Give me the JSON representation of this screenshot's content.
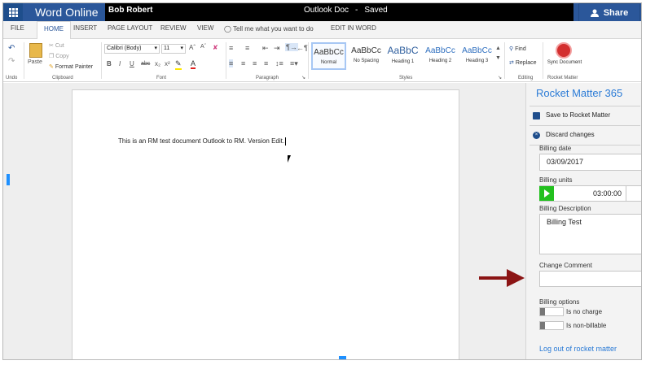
{
  "app": {
    "name": "Word Online",
    "user": "Bob Robert",
    "document_title": "Outlook Doc",
    "separator": "-",
    "save_status": "Saved",
    "share_label": "Share"
  },
  "menu": {
    "tabs": [
      {
        "label": "FILE"
      },
      {
        "label": "HOME"
      },
      {
        "label": "INSERT"
      },
      {
        "label": "PAGE LAYOUT"
      },
      {
        "label": "REVIEW"
      },
      {
        "label": "VIEW"
      }
    ],
    "tell_me": "Tell me what you want to do",
    "edit_in_word": "EDIT IN WORD"
  },
  "ribbon": {
    "undo_group": "Undo",
    "paste": "Paste",
    "cut": "Cut",
    "copy": "Copy",
    "format_painter": "Format Painter",
    "clipboard_group": "Clipboard",
    "font_name": "Calibri (Body)",
    "font_size": "11",
    "font_group": "Font",
    "paragraph_group": "Paragraph",
    "styles": [
      {
        "sample": "AaBbCc",
        "name": "Normal"
      },
      {
        "sample": "AaBbCc",
        "name": "No Spacing"
      },
      {
        "sample": "AaBbC",
        "name": "Heading 1"
      },
      {
        "sample": "AaBbCc",
        "name": "Heading 2"
      },
      {
        "sample": "AaBbCc",
        "name": "Heading 3"
      }
    ],
    "styles_group": "Styles",
    "find": "Find",
    "replace": "Replace",
    "editing_group": "Editing",
    "sync_document": "Sync Document",
    "rocket_matter_group": "Rocket Matter"
  },
  "document": {
    "body_text": "This is an RM test document Outlook to RM. Version Edit."
  },
  "pane": {
    "title": "Rocket Matter 365",
    "save_button": "Save to Rocket Matter",
    "discard_button": "Discard changes",
    "billing_date_label": "Billing date",
    "billing_date_value": "03/09/2017",
    "billing_units_label": "Billing units",
    "billing_units_value": "03:00:00",
    "billing_description_label": "Billing Description",
    "billing_description_value": "Billing Test",
    "change_comment_label": "Change Comment",
    "change_comment_value": "",
    "billing_options_label": "Billing options",
    "option_no_charge": "Is no charge",
    "option_non_billable": "Is non-billable",
    "logout_link": "Log out of rocket matter"
  },
  "colors": {
    "word_blue": "#2b579a",
    "pane_accent": "#2b7bd6",
    "play_green": "#22c01e",
    "arrow_red": "#8b1414"
  }
}
